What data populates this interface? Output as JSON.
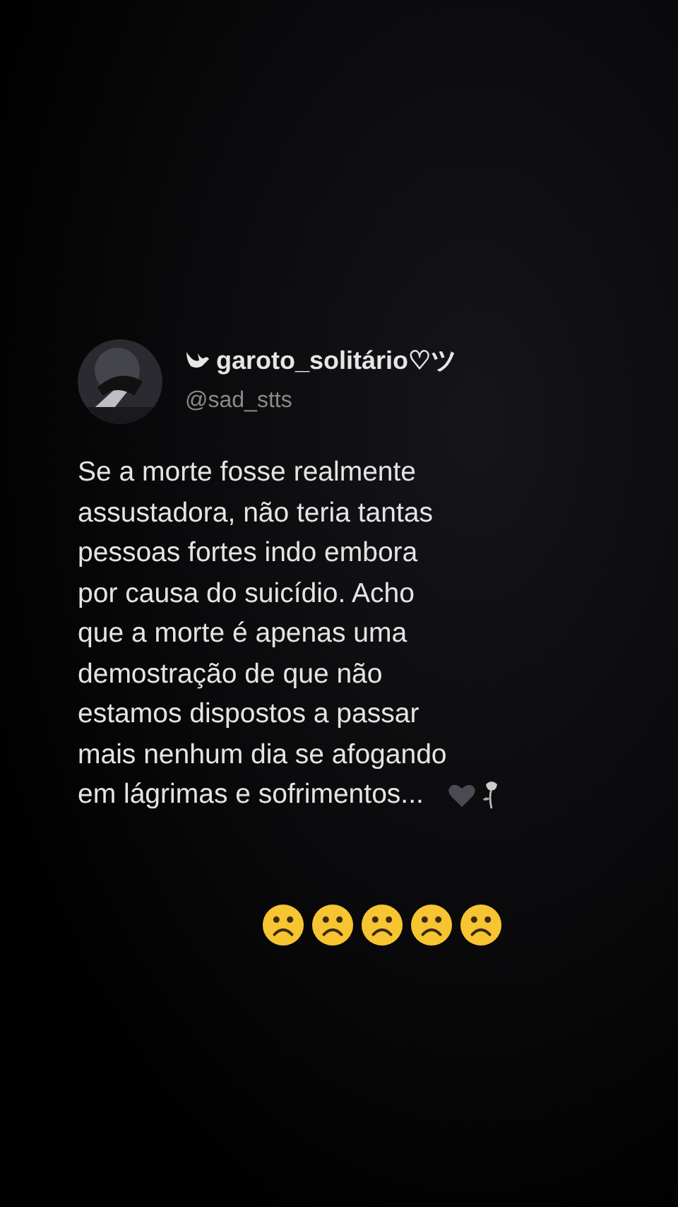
{
  "post": {
    "display_name": "garoto_solitário♡ツ",
    "handle": "@sad_stts",
    "text": "Se a morte fosse realmente\nassustadora, não teria tantas\npessoas fortes indo embora\npor causa do suicídio. Acho\nque a morte é apenas uma\ndemostração de que não\nestamos dispostos a passar\nmais nenhum dia se afogando\nem lágrimas e sofrimentos..."
  }
}
